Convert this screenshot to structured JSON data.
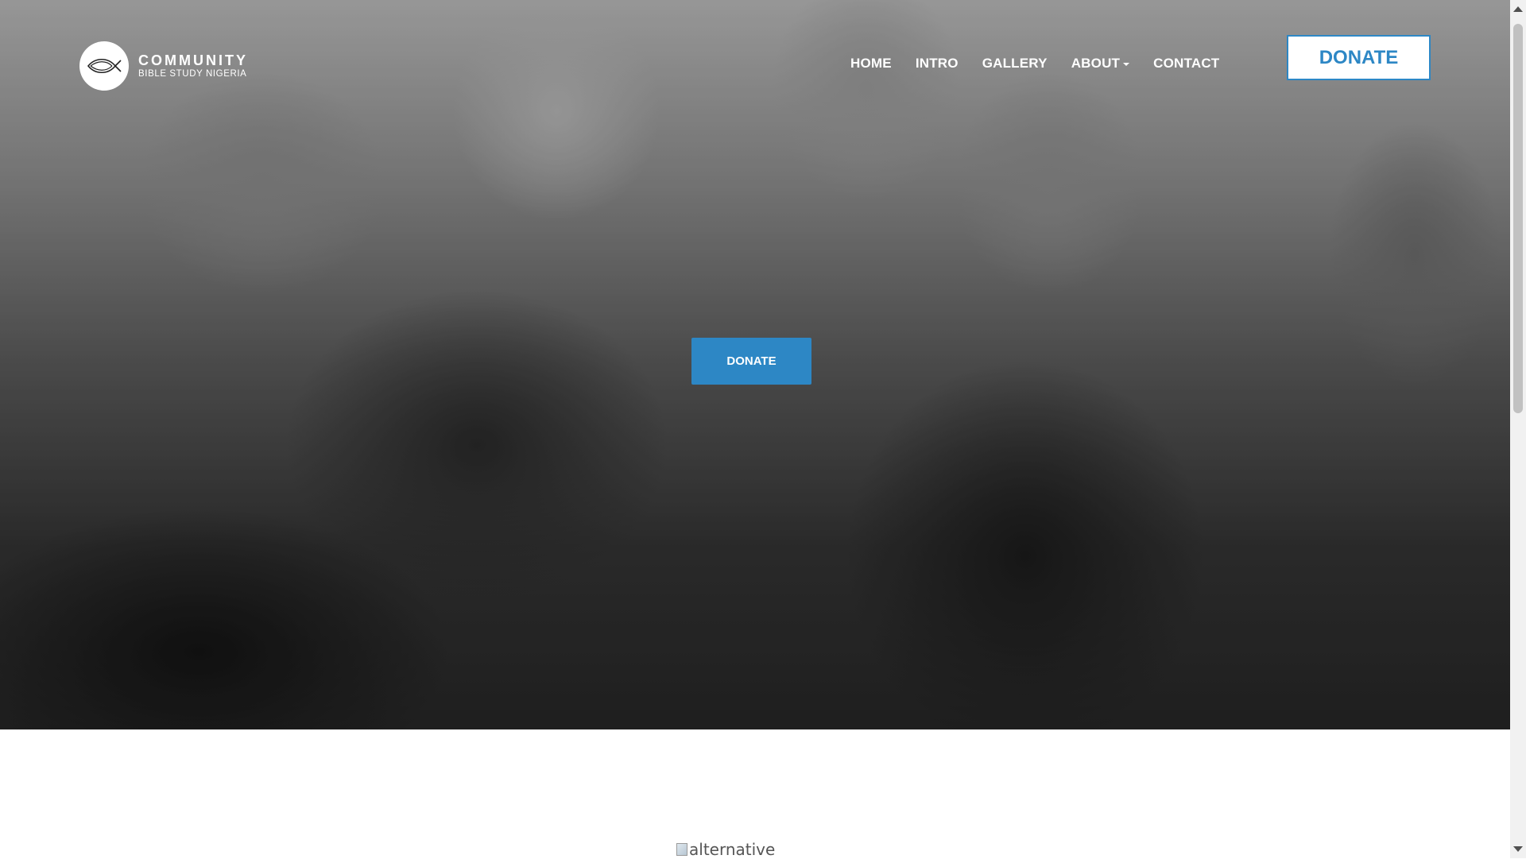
{
  "brand": {
    "name": "COMMUNITY",
    "tagline": "BIBLE STUDY NIGERIA",
    "icon": "fish-icon"
  },
  "nav": {
    "items": [
      {
        "label": "HOME"
      },
      {
        "label": "INTRO"
      },
      {
        "label": "GALLERY"
      },
      {
        "label": "ABOUT",
        "dropdown": true
      },
      {
        "label": "CONTACT"
      }
    ]
  },
  "header_donate_label": "DONATE",
  "hero": {
    "background": "group-of-people-photo",
    "donate_label": "DONATE"
  },
  "content": {
    "image_alt": "alternative"
  },
  "colors": {
    "accent": "#2d87c5",
    "nav_text": "#ffffff"
  }
}
